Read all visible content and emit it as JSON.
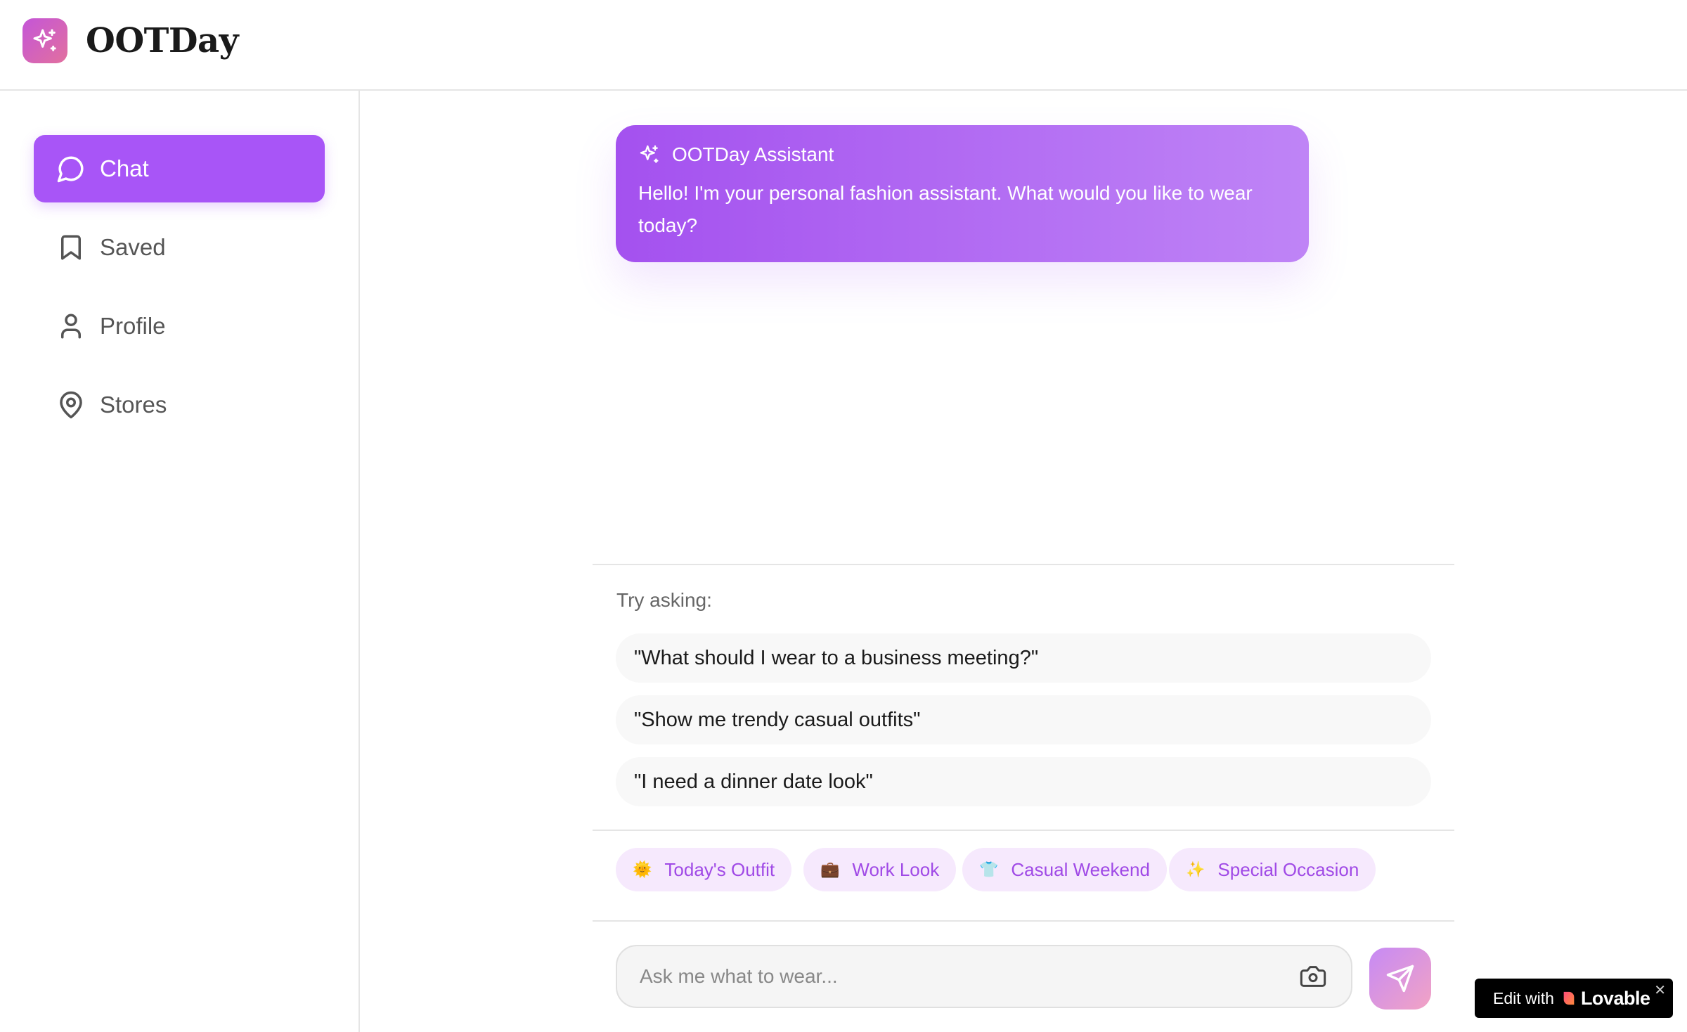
{
  "app": {
    "name": "OOTDay",
    "logo_icon": "sparkles-icon",
    "brand_gradient": [
      "#c455d8",
      "#e2709e"
    ]
  },
  "sidebar": {
    "items": [
      {
        "label": "Chat",
        "icon": "message-circle-icon",
        "active": true
      },
      {
        "label": "Saved",
        "icon": "bookmark-icon",
        "active": false
      },
      {
        "label": "Profile",
        "icon": "user-icon",
        "active": false
      },
      {
        "label": "Stores",
        "icon": "map-pin-icon",
        "active": false
      }
    ],
    "active_color": "#a855f7"
  },
  "chat": {
    "assistant_name": "OOTDay Assistant",
    "greeting": "Hello! I'm your personal fashion assistant. What would you like to wear today?"
  },
  "suggestions": {
    "label": "Try asking:",
    "items": [
      "\"What should I wear to a business meeting?\"",
      "\"Show me trendy casual outfits\"",
      "\"I need a dinner date look\""
    ]
  },
  "quick_actions": [
    {
      "emoji": "🌞",
      "label": "Today's Outfit"
    },
    {
      "emoji": "💼",
      "label": "Work Look"
    },
    {
      "emoji": "👕",
      "label": "Casual Weekend"
    },
    {
      "emoji": "✨",
      "label": "Special Occasion"
    }
  ],
  "composer": {
    "placeholder": "Ask me what to wear...",
    "camera_icon": "camera-icon",
    "send_icon": "send-icon"
  },
  "badge": {
    "prefix": "Edit with",
    "brand": "Lovable",
    "close": "✕"
  }
}
